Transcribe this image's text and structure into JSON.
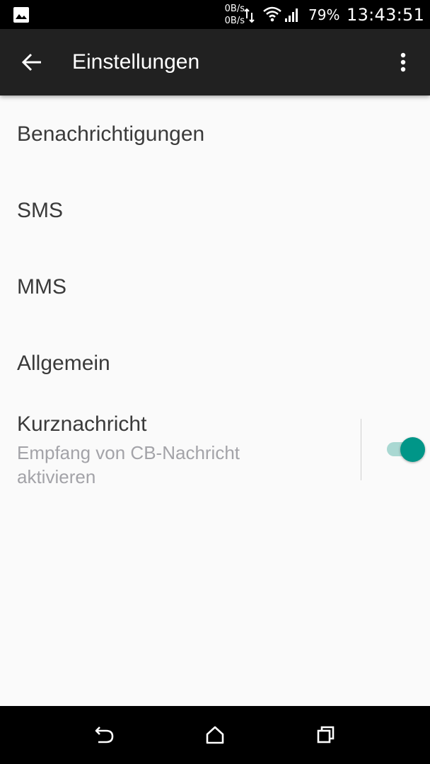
{
  "status_bar": {
    "speed_up": "0B/s",
    "speed_down": "0B/s",
    "battery": "79%",
    "clock": "13:43:51",
    "icons": [
      "gallery-icon",
      "data-transfer-icon",
      "wifi-icon",
      "signal-icon"
    ]
  },
  "toolbar": {
    "title": "Einstellungen",
    "back_icon": "arrow-back-icon",
    "menu_icon": "more-vert-icon"
  },
  "settings": {
    "items": [
      {
        "label": "Benachrichtigungen"
      },
      {
        "label": "SMS"
      },
      {
        "label": "MMS"
      },
      {
        "label": "Allgemein"
      },
      {
        "label": "Kurznachricht",
        "summary": "Empfang von CB-Nachricht aktivieren",
        "toggle_on": true
      }
    ]
  },
  "nav_bar": {
    "icons": [
      "nav-back-icon",
      "nav-home-icon",
      "nav-recents-icon"
    ]
  },
  "colors": {
    "accent": "#009688",
    "toolbar": "#212121",
    "background": "#fafafa"
  }
}
